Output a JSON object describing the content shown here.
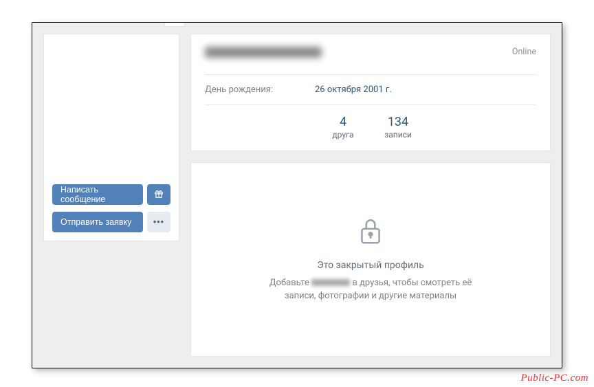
{
  "sidebar": {
    "message_button": "Написать сообщение",
    "request_button": "Отправить заявку",
    "gift_icon": "gift",
    "more_icon": "more"
  },
  "header": {
    "status": "Online",
    "info": {
      "birthday_label": "День рождения:",
      "birthday_value": "26 октября 2001 г."
    },
    "stats": {
      "friends_count": "4",
      "friends_label": "друга",
      "posts_count": "134",
      "posts_label": "записи"
    }
  },
  "private": {
    "title": "Это закрытый профиль",
    "desc_prefix": "Добавьте ",
    "desc_suffix": " в друзья, чтобы смотреть её записи, фотографии и другие материалы"
  },
  "watermark": "Public-PC.com"
}
